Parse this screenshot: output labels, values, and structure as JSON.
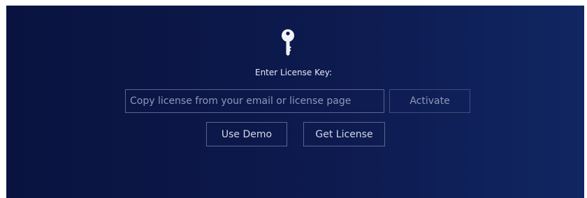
{
  "license": {
    "icon": "key-icon",
    "prompt": "Enter License Key:",
    "input_placeholder": "Copy license from your email or license page",
    "input_value": "",
    "activate_label": "Activate",
    "use_demo_label": "Use Demo",
    "get_license_label": "Get License"
  },
  "colors": {
    "background_dark": "#0a133f",
    "background_light": "#112662",
    "border": "#5a6590",
    "text": "#e7e9f2"
  }
}
